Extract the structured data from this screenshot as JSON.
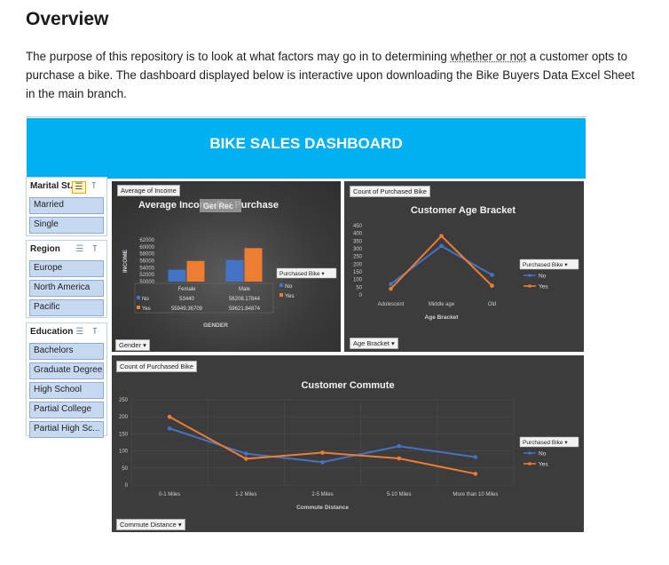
{
  "doc": {
    "heading": "Overview",
    "para_before": "The purpose of this repository is to look at what factors may go in to determining ",
    "para_dotted": "whether or not",
    "para_after": " a customer opts to purchase a bike. The dashboard displayed below is interactive upon downloading the Bike Buyers Data Excel Sheet in the main branch."
  },
  "dashboard": {
    "banner_title": "BIKE SALES DASHBOARD",
    "slicers": {
      "marital": {
        "title": "Marital St...",
        "items": [
          "Married",
          "Single"
        ]
      },
      "region": {
        "title": "Region",
        "items": [
          "Europe",
          "North America",
          "Pacific"
        ]
      },
      "education": {
        "title": "Education",
        "items": [
          "Bachelors",
          "Graduate Degree",
          "High School",
          "Partial College",
          "Partial High Sc..."
        ]
      }
    },
    "colors": {
      "no": "#4472c4",
      "yes": "#ed7d31",
      "banner": "#00b0f0",
      "panel": "#3c3c3c"
    }
  },
  "chart_data": [
    {
      "type": "bar",
      "tag": "Average of Income",
      "title": "Average Income Per Purchase",
      "overlay_label": "Get Rec",
      "ylabel": "INCOME",
      "xlabel": "GENDER",
      "categories": [
        "Female",
        "Male"
      ],
      "series": [
        {
          "name": "No",
          "values": [
            53440,
            56208.17844
          ],
          "labels": [
            "53440",
            "56208.17844"
          ]
        },
        {
          "name": "Yes",
          "values": [
            55949.36709,
            59621.84874
          ],
          "labels": [
            "55949.36709",
            "59621.84874"
          ]
        }
      ],
      "ylim": [
        50000,
        62000
      ],
      "yticks": [
        50000,
        52000,
        54000,
        56000,
        58000,
        60000,
        62000
      ],
      "legend_title": "Purchased Bike",
      "filter_button": "Gender"
    },
    {
      "type": "line",
      "tag": "Count of Purchased Bike",
      "title": "Customer Age Bracket",
      "xlabel": "Age Bracket",
      "categories": [
        "Adolescent",
        "Middle age",
        "Old"
      ],
      "series": [
        {
          "name": "No",
          "values": [
            71,
            318,
            130
          ]
        },
        {
          "name": "Yes",
          "values": [
            40,
            383,
            60
          ]
        }
      ],
      "ylim": [
        0,
        450
      ],
      "yticks": [
        0,
        50,
        100,
        150,
        200,
        250,
        300,
        350,
        400,
        450
      ],
      "legend_title": "Purchased Bike",
      "filter_button": "Age Bracket"
    },
    {
      "type": "line",
      "tag": "Count of Purchased Bike",
      "title": "Customer Commute",
      "xlabel": "Commute Distance",
      "categories": [
        "0-1 Miles",
        "1-2 Miles",
        "2-5 Miles",
        "5-10 Miles",
        "More than 10 Miles"
      ],
      "series": [
        {
          "name": "No",
          "values": [
            166,
            92,
            67,
            114,
            82
          ]
        },
        {
          "name": "Yes",
          "values": [
            200,
            77,
            95,
            78,
            33
          ]
        }
      ],
      "ylim": [
        0,
        250
      ],
      "yticks": [
        0,
        50,
        100,
        150,
        200,
        250
      ],
      "legend_title": "Purchased Bike",
      "filter_button": "Commute Distance"
    }
  ]
}
